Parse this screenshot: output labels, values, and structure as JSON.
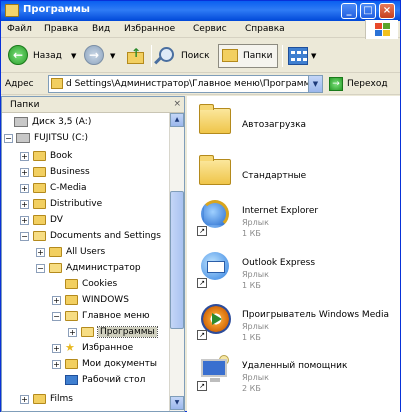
{
  "window": {
    "title": "Программы",
    "controls": {
      "minimize": "_",
      "maximize": "□",
      "close": "×"
    }
  },
  "menu": {
    "items": [
      "Файл",
      "Правка",
      "Вид",
      "Избранное",
      "Сервис",
      "Справка"
    ]
  },
  "toolbar": {
    "back_label": "Назад",
    "forward_arrow": "▼",
    "search_label": "Поиск",
    "folders_label": "Папки",
    "views_arrow": "▼"
  },
  "address": {
    "label": "Адрес",
    "value": "d Settings\\Администратор\\Главное меню\\Программы",
    "go_label": "Переход"
  },
  "folders_pane": {
    "title": "Папки",
    "close": "×",
    "tree": [
      {
        "label": "Диск 3,5 (A:)",
        "expander": ""
      },
      {
        "label": "FUJITSU (C:)",
        "expander": "−"
      },
      {
        "label": "Book",
        "expander": "+"
      },
      {
        "label": "Business",
        "expander": "+"
      },
      {
        "label": "C-Media",
        "expander": "+"
      },
      {
        "label": "Distributive",
        "expander": "+"
      },
      {
        "label": "DV",
        "expander": "+"
      },
      {
        "label": "Documents and Settings",
        "expander": "−"
      },
      {
        "label": "All Users",
        "expander": "+"
      },
      {
        "label": "Администратор",
        "expander": "−"
      },
      {
        "label": "Cookies",
        "expander": ""
      },
      {
        "label": "WINDOWS",
        "expander": "+"
      },
      {
        "label": "Главное меню",
        "expander": "−"
      },
      {
        "label": "Программы",
        "expander": "+"
      },
      {
        "label": "Избранное",
        "expander": "+"
      },
      {
        "label": "Мои документы",
        "expander": "+"
      },
      {
        "label": "Рабочий стол",
        "expander": ""
      },
      {
        "label": "Films",
        "expander": "+"
      }
    ]
  },
  "content": {
    "items": [
      {
        "name": "Автозагрузка",
        "type": "",
        "size": "",
        "icon": "folder-icon"
      },
      {
        "name": "Стандартные",
        "type": "",
        "size": "",
        "icon": "folder-icon"
      },
      {
        "name": "Internet Explorer",
        "type": "Ярлык",
        "size": "1 КБ",
        "icon": "internet-explorer-icon"
      },
      {
        "name": "Outlook Express",
        "type": "Ярлык",
        "size": "1 КБ",
        "icon": "outlook-express-icon"
      },
      {
        "name": "Проигрыватель Windows Media",
        "type": "Ярлык",
        "size": "1 КБ",
        "icon": "windows-media-player-icon"
      },
      {
        "name": "Удаленный помощник",
        "type": "Ярлык",
        "size": "2 КБ",
        "icon": "remote-assistance-icon"
      }
    ]
  },
  "colors": {
    "title_bar": "#0a5ff0",
    "selection": "#d0d0bf",
    "folder": "#f2cf60"
  }
}
